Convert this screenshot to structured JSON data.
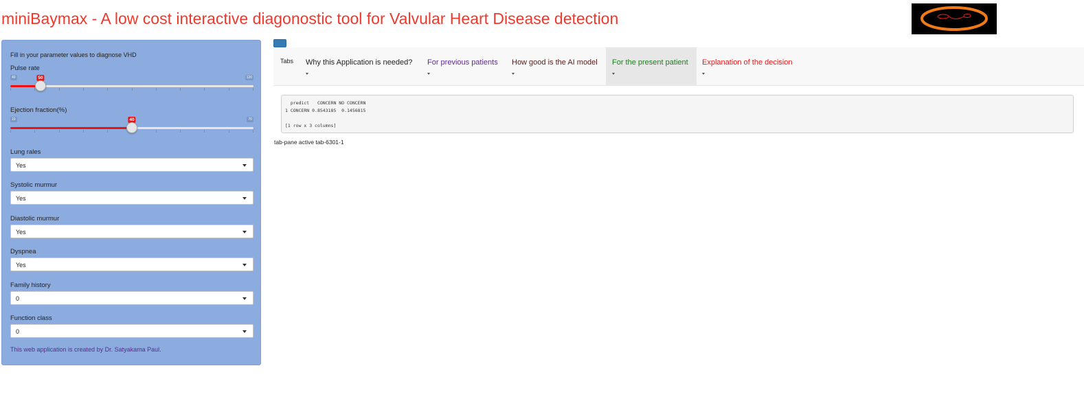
{
  "header": {
    "title": "miniBaymax - A low cost interactive diagonostic tool for Valvular Heart Disease detection",
    "title_color": "#f0392b",
    "logo_icon": "heart-ring-logo"
  },
  "sidebar": {
    "intro": "Fill in your parameter values to diagnose VHD",
    "pulse": {
      "label": "Pulse rate",
      "min": "40",
      "max": "120",
      "value": "50",
      "fraction": 0.125
    },
    "ejection": {
      "label": "Ejection fraction(%)",
      "min": "10",
      "max": "70",
      "value": "40",
      "fraction": 0.5
    },
    "selects": [
      {
        "label": "Lung rales",
        "value": "Yes"
      },
      {
        "label": "Systolic murmur",
        "value": "Yes"
      },
      {
        "label": "Diastolic murmur",
        "value": "Yes"
      },
      {
        "label": "Dyspnea",
        "value": "Yes"
      },
      {
        "label": "Family history",
        "value": "0"
      },
      {
        "label": "Function class",
        "value": "0"
      }
    ],
    "credit": "This web application is created by Dr. Satyakama Paul.",
    "accent": "#ee1111",
    "background": "#8cacdf"
  },
  "tabs": {
    "label": "Tabs",
    "items": [
      {
        "label": "Why this Application is needed?",
        "color": "#222222"
      },
      {
        "label": "For previous patients",
        "color": "#5b2c8f"
      },
      {
        "label": "How good is the AI model",
        "color": "#5a1a1a"
      },
      {
        "label": "For the present patient",
        "color": "#1e7b1e"
      },
      {
        "label": "Explanation of the decision",
        "color": "#e21a1a"
      }
    ],
    "active_index": 3
  },
  "output": {
    "lines": [
      "  predict   CONCERN NO CONCERN",
      "1 CONCERN 0.8543185  0.1456815",
      "",
      "[1 row x 3 columns]"
    ]
  },
  "pane_text": "tab-pane active tab-6301-1"
}
